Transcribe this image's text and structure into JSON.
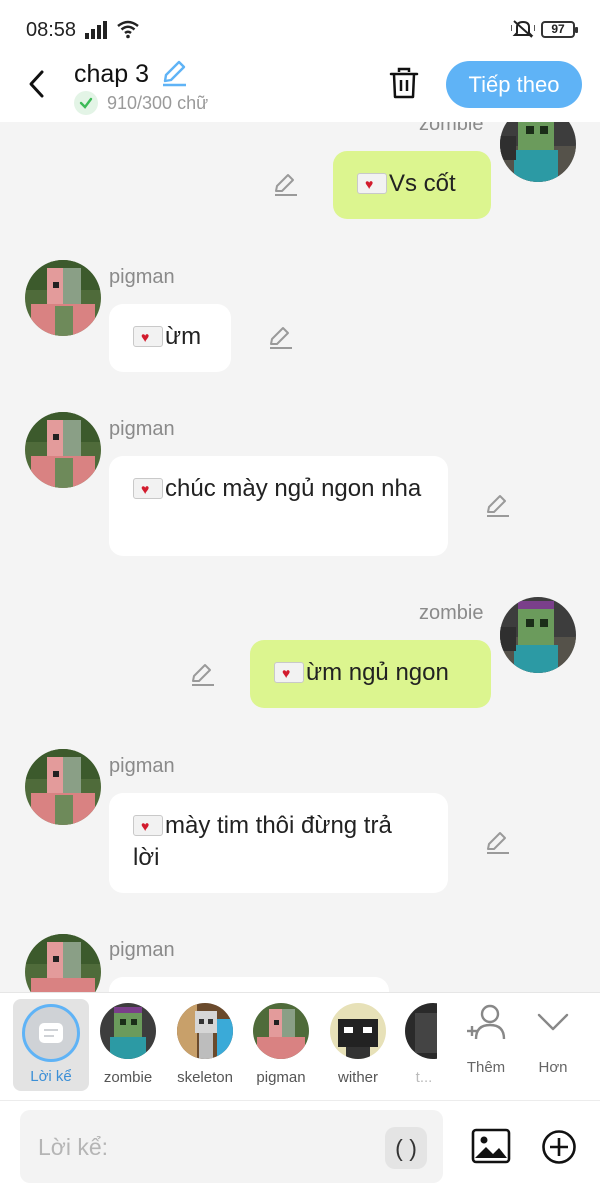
{
  "status_bar": {
    "time": "08:58",
    "battery": "97"
  },
  "header": {
    "title": "chap 3",
    "word_count": "910/300 chữ",
    "next_label": "Tiếp theo"
  },
  "messages": [
    {
      "sender": "zombie",
      "side": "right",
      "text": "Vs cốt"
    },
    {
      "sender": "pigman",
      "side": "left",
      "text": "ừm"
    },
    {
      "sender": "pigman",
      "side": "left",
      "text": "chúc mày ngủ ngon nha"
    },
    {
      "sender": "zombie",
      "side": "right",
      "text": "ừm ngủ ngon"
    },
    {
      "sender": "pigman",
      "side": "left",
      "text": "mày tim thôi đừng trả lời"
    },
    {
      "sender": "pigman",
      "side": "left",
      "text": ""
    }
  ],
  "character_bar": {
    "narrator_label": "Lời kể",
    "characters": [
      "zombie",
      "skeleton",
      "pigman",
      "wither",
      "t..."
    ],
    "add_label": "Thêm",
    "more_label": "Hơn"
  },
  "input": {
    "placeholder": "Lời kể:",
    "paren_label": "( )"
  },
  "colors": {
    "accent": "#5fb3f6",
    "right_bubble": "#dcf58f",
    "left_bubble": "#ffffff",
    "background": "#f4f4f4"
  }
}
